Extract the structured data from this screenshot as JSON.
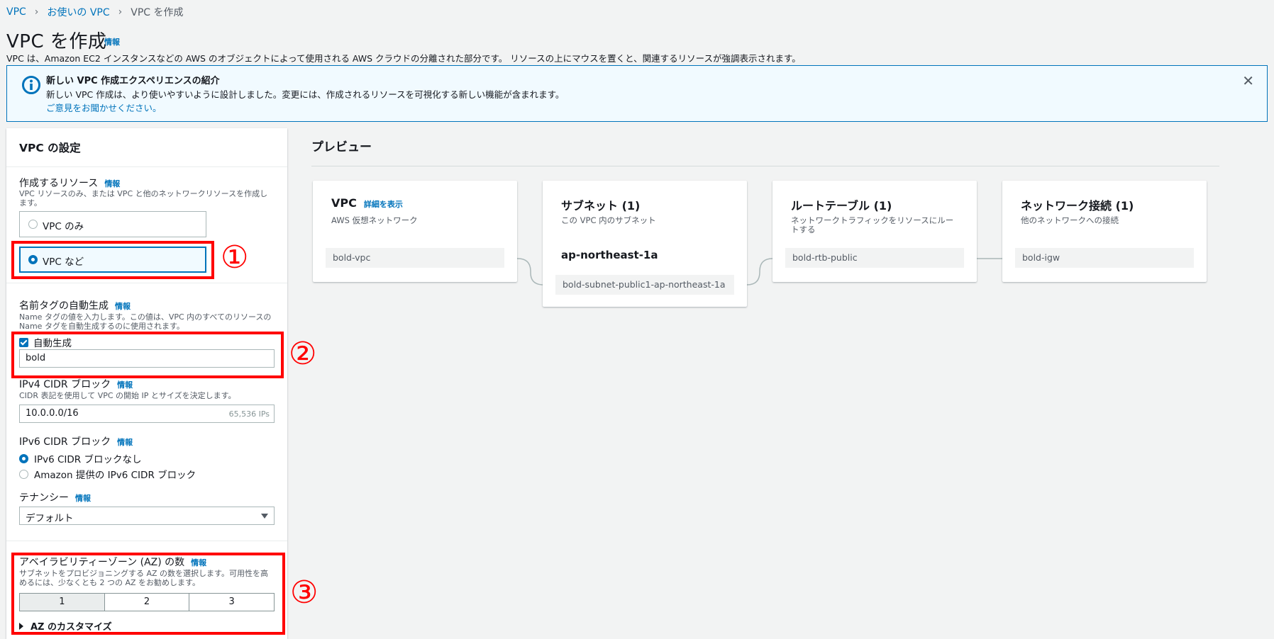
{
  "breadcrumb": [
    "VPC",
    "お使いの VPC",
    "VPC を作成"
  ],
  "header": {
    "title": "VPC を作成",
    "info": "情報",
    "description": "VPC は、Amazon EC2 インスタンスなどの AWS のオブジェクトによって使用される AWS クラウドの分離された部分です。 リソースの上にマウスを置くと、関連するリソースが強調表示されます。"
  },
  "flash": {
    "title": "新しい VPC 作成エクスペリエンスの紹介",
    "body": "新しい VPC 作成は、より使いやすいように設計しました。変更には、作成されるリソースを可視化する新しい機能が含まれます。",
    "link": "ご意見をお聞かせください。"
  },
  "settings": {
    "title": "VPC の設定",
    "info": "情報",
    "resources": {
      "label": "作成するリソース",
      "description": "VPC リソースのみ、または VPC と他のネットワークリソースを作成します。",
      "options": [
        "VPC のみ",
        "VPC など"
      ],
      "selected": "VPC など"
    },
    "name_tag": {
      "label": "名前タグの自動生成",
      "description": "Name タグの値を入力します。この値は、VPC 内のすべてのリソースの Name タグを自動生成するのに使用されます。",
      "checkbox_label": "自動生成",
      "value": "bold"
    },
    "ipv4": {
      "label": "IPv4 CIDR ブロック",
      "description": "CIDR 表記を使用して VPC の開始 IP とサイズを決定します。",
      "value": "10.0.0.0/16",
      "suffix": "65,536 IPs"
    },
    "ipv6": {
      "label": "IPv6 CIDR ブロック",
      "options": [
        "IPv6 CIDR ブロックなし",
        "Amazon 提供の IPv6 CIDR ブロック"
      ],
      "selected": "IPv6 CIDR ブロックなし"
    },
    "tenancy": {
      "label": "テナンシー",
      "value": "デフォルト"
    },
    "az": {
      "label": "アベイラビリティーゾーン (AZ) の数",
      "description": "サブネットをプロビジョニングする AZ の数を選択します。可用性を高めるには、少なくとも 2 つの AZ をお勧めします。",
      "options": [
        "1",
        "2",
        "3"
      ],
      "selected": "1",
      "customize": "AZ のカスタマイズ"
    }
  },
  "annotations": [
    "①",
    "②",
    "③"
  ],
  "preview": {
    "title": "プレビュー",
    "cards": [
      {
        "title": "VPC",
        "link": "詳細を表示",
        "description": "AWS 仮想ネットワーク",
        "resources": [
          "bold-vpc"
        ]
      },
      {
        "title": "サブネット (1)",
        "description": "この VPC 内のサブネット",
        "group": "ap-northeast-1a",
        "resources": [
          "bold-subnet-public1-ap-northeast-1a"
        ]
      },
      {
        "title": "ルートテーブル (1)",
        "description": "ネットワークトラフィックをリソースにルートする",
        "resources": [
          "bold-rtb-public"
        ]
      },
      {
        "title": "ネットワーク接続 (1)",
        "description": "他のネットワークへの接続",
        "resources": [
          "bold-igw"
        ]
      }
    ]
  },
  "colors": {
    "accent": "#0073bb",
    "highlight": "#ff0000",
    "flash_bg": "#f1faff"
  }
}
